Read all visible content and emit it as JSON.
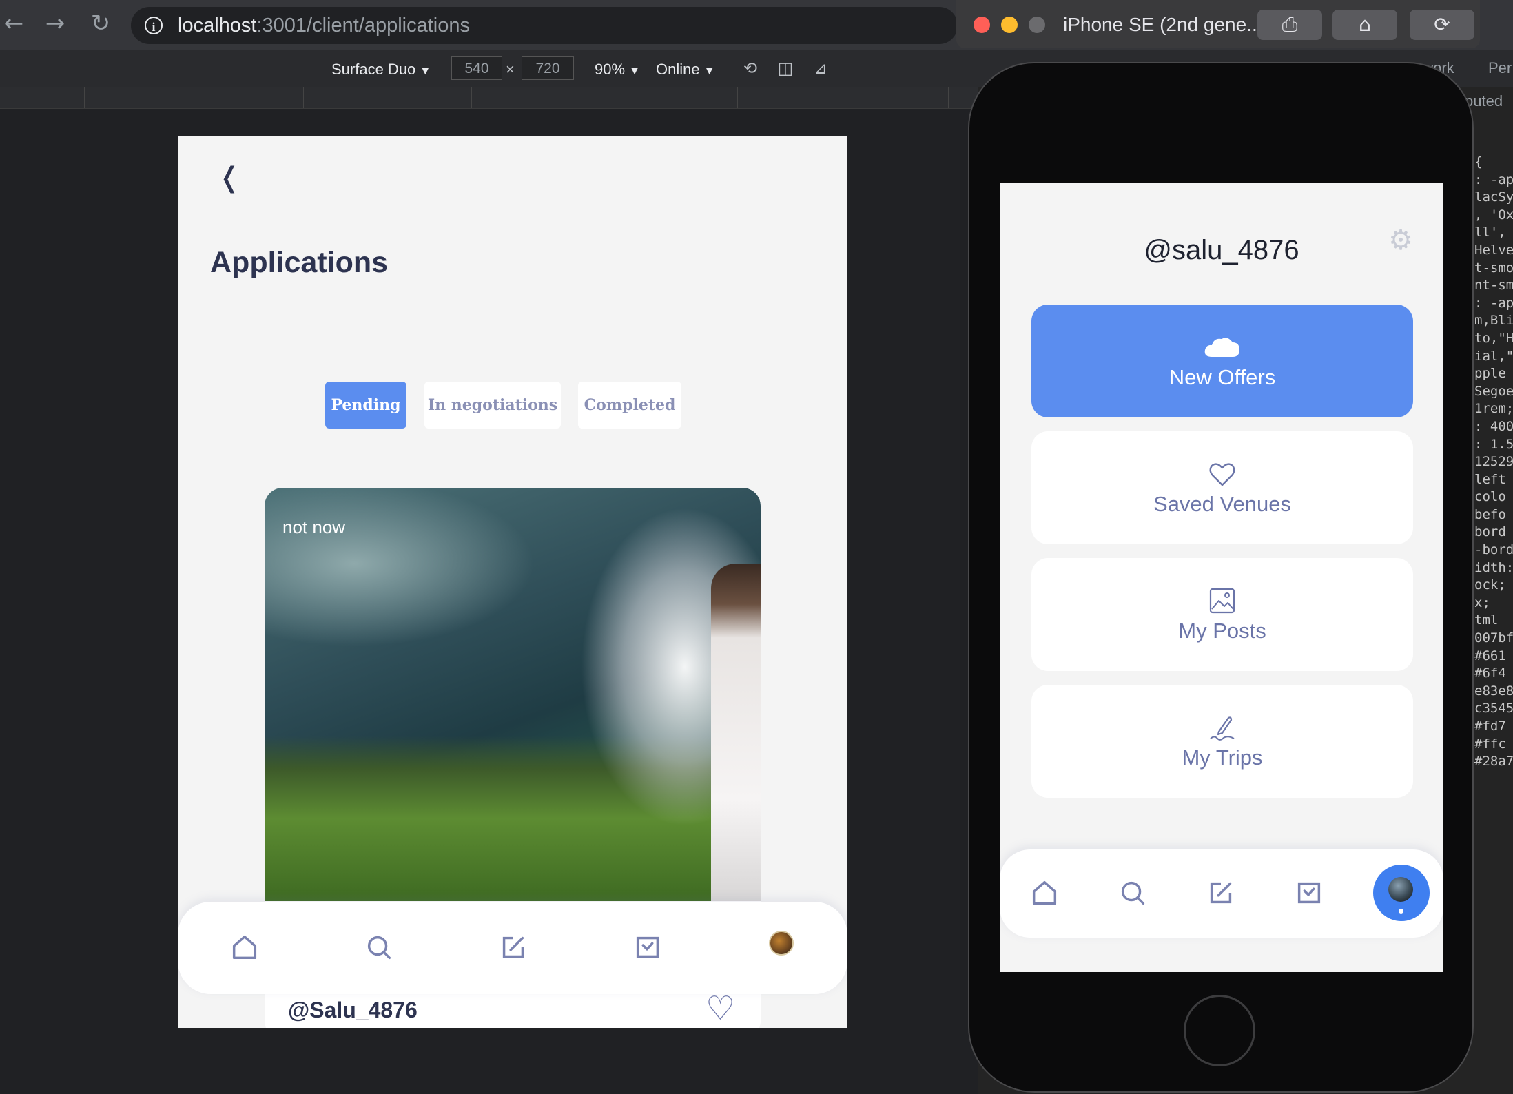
{
  "browser": {
    "url_host": "localhost",
    "url_path": ":3001/client/applications"
  },
  "device_toolbar": {
    "device": "Surface Duo",
    "width": "540",
    "times": "×",
    "height": "720",
    "zoom": "90%",
    "network": "Online"
  },
  "devtools": {
    "tabs": [
      "Network",
      "Per"
    ],
    "computed_label": "puted",
    "code_lines": [
      "{",
      ": -ap",
      "lacSy",
      ", 'Ox",
      "ll',",
      "Helve",
      "t-smo",
      "nt-sm",
      ": -ap",
      "m,Bli",
      "to,\"H",
      "ial,\"",
      "pple",
      "Segoe",
      "1rem;",
      ": 400",
      ": 1.5",
      "12529",
      " left",
      "colo",
      "befo",
      " bord",
      "-bord",
      "idth:",
      "ock;",
      "x;",
      "tml",
      "007bf",
      "#661",
      "#6f4",
      "e83e8",
      "c3545",
      "#fd7",
      "#ffc",
      "#28a7"
    ]
  },
  "left_app": {
    "page_title": "Applications",
    "tabs": [
      {
        "label": "Pending",
        "active": true
      },
      {
        "label": "In negotiations",
        "active": false
      },
      {
        "label": "Completed",
        "active": false
      }
    ],
    "card": {
      "label": "not now",
      "name": "@Salu_4876"
    }
  },
  "simulator": {
    "title": "iPhone SE (2nd gene...",
    "buttons": [
      "screenshot-icon",
      "home-icon",
      "rotate-icon"
    ]
  },
  "right_app": {
    "handle": "@salu_4876",
    "menu": [
      {
        "label": "New Offers",
        "icon": "cloud-icon",
        "primary": true
      },
      {
        "label": "Saved Venues",
        "icon": "heart-icon",
        "primary": false
      },
      {
        "label": "My Posts",
        "icon": "image-icon",
        "primary": false
      },
      {
        "label": "My Trips",
        "icon": "pen-icon",
        "primary": false
      }
    ]
  },
  "colors": {
    "accent": "#5b8def",
    "text_dark": "#2d3350",
    "text_muted": "#6a74a8",
    "background": "#f4f4f4"
  }
}
